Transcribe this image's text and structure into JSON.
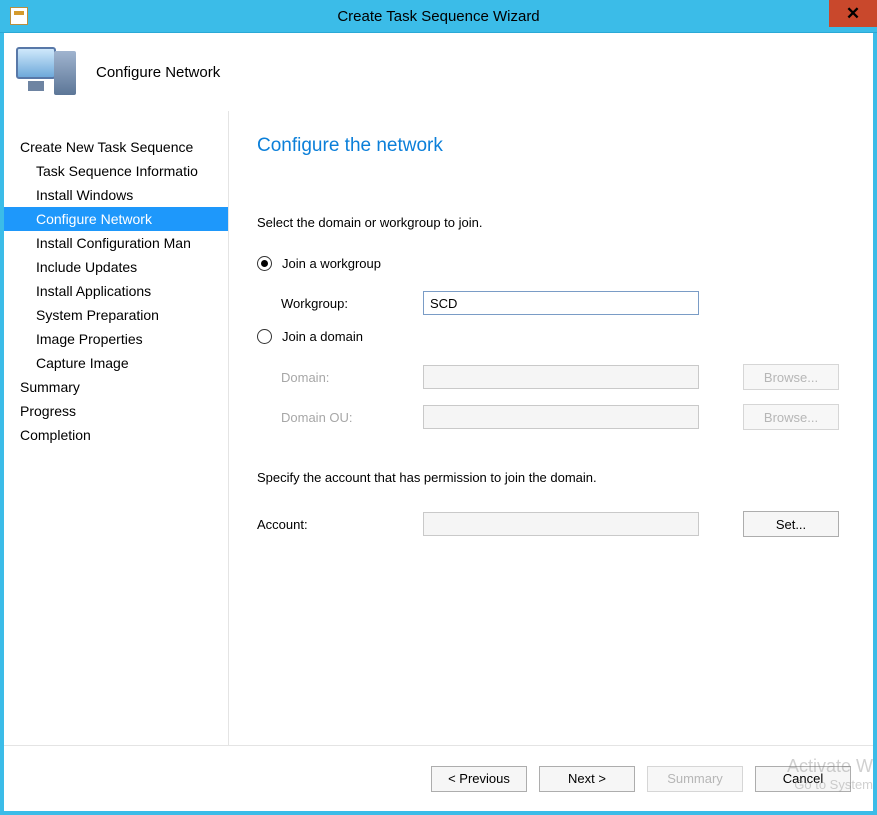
{
  "titlebar": {
    "title": "Create Task Sequence Wizard",
    "close_glyph": "✕"
  },
  "header": {
    "page_name": "Configure Network"
  },
  "sidebar": {
    "items": [
      {
        "label": "Create New Task Sequence",
        "sub": false,
        "selected": false
      },
      {
        "label": "Task Sequence Informatio",
        "sub": true,
        "selected": false
      },
      {
        "label": "Install Windows",
        "sub": true,
        "selected": false
      },
      {
        "label": "Configure Network",
        "sub": true,
        "selected": true
      },
      {
        "label": "Install Configuration Man",
        "sub": true,
        "selected": false
      },
      {
        "label": "Include Updates",
        "sub": true,
        "selected": false
      },
      {
        "label": "Install Applications",
        "sub": true,
        "selected": false
      },
      {
        "label": "System Preparation",
        "sub": true,
        "selected": false
      },
      {
        "label": "Image Properties",
        "sub": true,
        "selected": false
      },
      {
        "label": "Capture Image",
        "sub": true,
        "selected": false
      },
      {
        "label": "Summary",
        "sub": false,
        "selected": false
      },
      {
        "label": "Progress",
        "sub": false,
        "selected": false
      },
      {
        "label": "Completion",
        "sub": false,
        "selected": false
      }
    ]
  },
  "main": {
    "heading": "Configure the network",
    "instruction": "Select the domain or workgroup to join.",
    "join_workgroup_label": "Join a workgroup",
    "workgroup_label": "Workgroup:",
    "workgroup_value": "SCD",
    "join_domain_label": "Join a domain",
    "domain_label": "Domain:",
    "domain_value": "",
    "domain_ou_label": "Domain OU:",
    "domain_ou_value": "",
    "browse_label": "Browse...",
    "account_instruction": "Specify the account that has permission to join the domain.",
    "account_label": "Account:",
    "account_value": "",
    "set_label": "Set..."
  },
  "footer": {
    "previous": "< Previous",
    "next": "Next >",
    "summary": "Summary",
    "cancel": "Cancel"
  },
  "watermark": {
    "line1": "Activate W",
    "line2": "Go to System"
  }
}
